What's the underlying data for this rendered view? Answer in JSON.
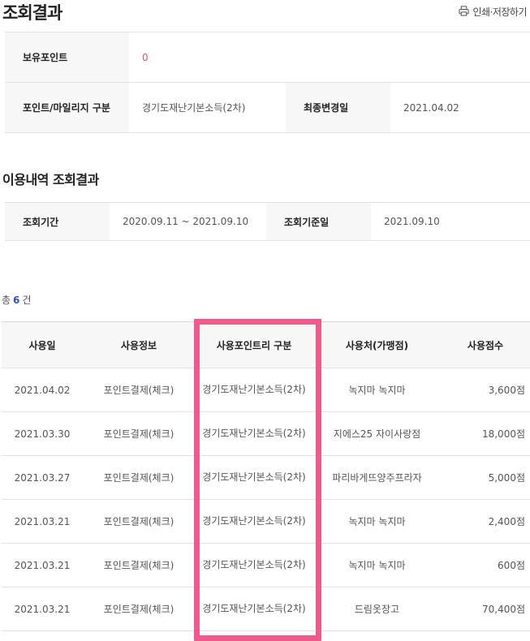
{
  "page": {
    "title": "조회결과",
    "print_label": "인쇄·저장하기"
  },
  "info": {
    "balance_label": "보유포인트",
    "balance_value": "0",
    "type_label": "포인트/마일리지 구분",
    "type_value": "경기도재난기본소득(2차)",
    "changed_label": "최종변경일",
    "changed_value": "2021.04.02"
  },
  "history_section": {
    "title": "이용내역 조회결과",
    "period_label": "조회기간",
    "period_value": "2020.09.11 ~ 2021.09.10",
    "base_label": "조회기준일",
    "base_value": "2021.09.10",
    "total_prefix": "총",
    "total_count": "6",
    "total_suffix": "건"
  },
  "table": {
    "headers": [
      "사용일",
      "사용정보",
      "사용포인트리 구분",
      "사용처(가맹점)",
      "사용점수"
    ],
    "rows": [
      {
        "date": "2021.04.02",
        "info": "포인트결제(체크)",
        "type": "경기도재난기본소득(2차)",
        "store": "녹지마 녹지마",
        "points": "3,600점"
      },
      {
        "date": "2021.03.30",
        "info": "포인트결제(체크)",
        "type": "경기도재난기본소득(2차)",
        "store": "지에스25 자이사랑점",
        "points": "18,000점"
      },
      {
        "date": "2021.03.27",
        "info": "포인트결제(체크)",
        "type": "경기도재난기본소득(2차)",
        "store": "파리바게뜨양주프라자",
        "points": "5,000점"
      },
      {
        "date": "2021.03.21",
        "info": "포인트결제(체크)",
        "type": "경기도재난기본소득(2차)",
        "store": "녹지마 녹지마",
        "points": "2,400점"
      },
      {
        "date": "2021.03.21",
        "info": "포인트결제(체크)",
        "type": "경기도재난기본소득(2차)",
        "store": "녹지마 녹지마",
        "points": "600점"
      },
      {
        "date": "2021.03.21",
        "info": "포인트결제(체크)",
        "type": "경기도재난기본소득(2차)",
        "store": "드림옷장고",
        "points": "70,400점"
      }
    ]
  },
  "colors": {
    "highlight": "#f05a8a",
    "point_value": "#e8516a",
    "count": "#2a4fd8"
  },
  "icons": {
    "print": "printer-icon"
  }
}
